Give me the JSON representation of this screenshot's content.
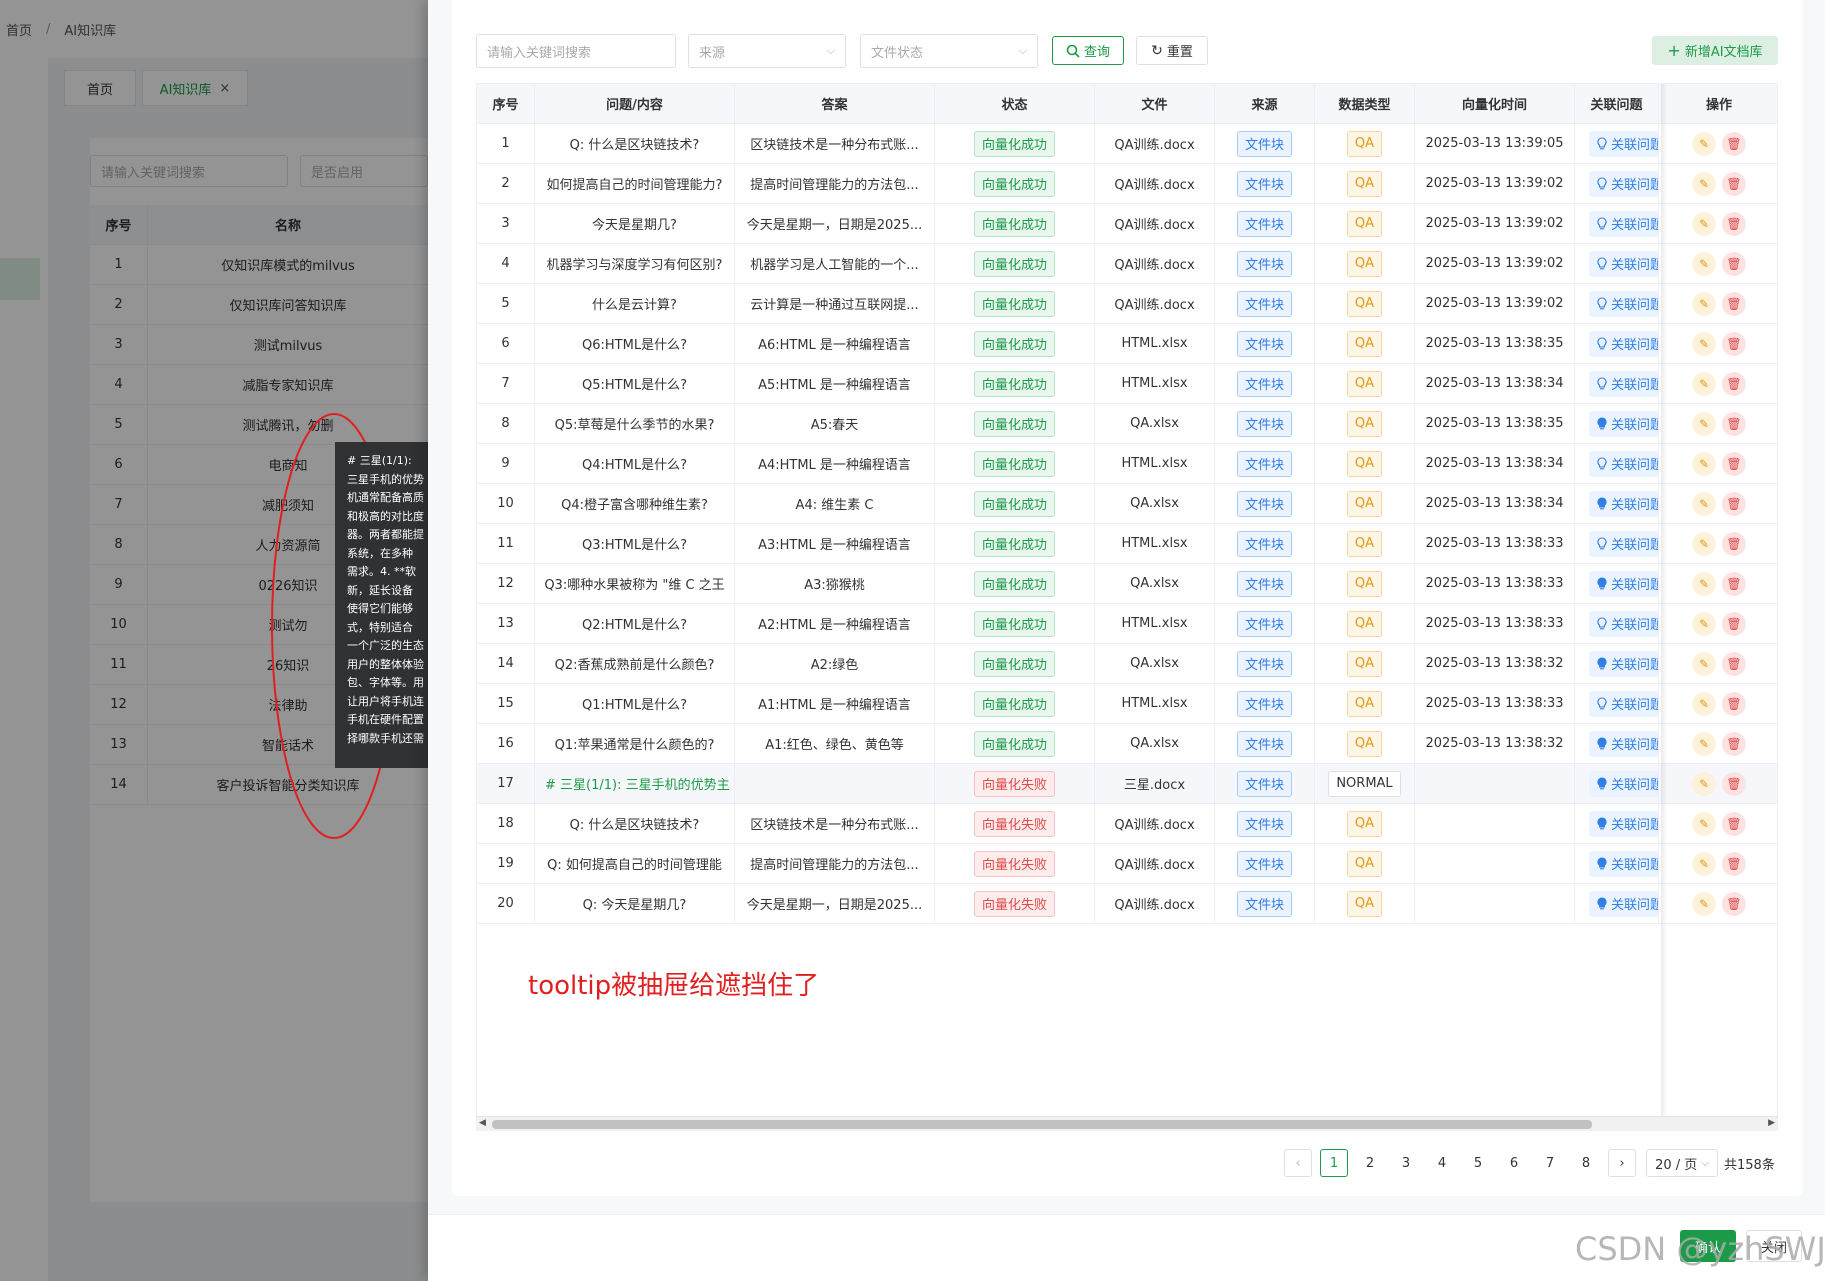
{
  "background": {
    "breadcrumb": [
      "首页",
      "AI知识库"
    ],
    "tabs": [
      "首页",
      "AI知识库"
    ],
    "search_placeholder": "请输入关键词搜索",
    "enabled_placeholder": "是否启用",
    "table": {
      "headers": [
        "序号",
        "名称"
      ],
      "rows": [
        [
          "1",
          "仅知识库模式的milvus"
        ],
        [
          "2",
          "仅知识库问答知识库"
        ],
        [
          "3",
          "测试milvus"
        ],
        [
          "4",
          "减脂专家知识库"
        ],
        [
          "5",
          "测试腾讯，勿删"
        ],
        [
          "6",
          "电商知"
        ],
        [
          "7",
          "减肥须知"
        ],
        [
          "8",
          "人力资源简"
        ],
        [
          "9",
          "0226知识"
        ],
        [
          "10",
          "测试勿"
        ],
        [
          "11",
          "26知识"
        ],
        [
          "12",
          "法律助"
        ],
        [
          "13",
          "智能话术"
        ],
        [
          "14",
          "客户投诉智能分类知识库"
        ]
      ]
    }
  },
  "tooltip": {
    "lines": [
      "# 三星(1/1):",
      "三星手机的优势",
      "机通常配备高质",
      "和极高的对比度",
      "器。两者都能提",
      "系统，在多种",
      "需求。4. **软",
      "新，延长设备",
      "使得它们能够",
      "式，特别适合",
      "一个广泛的生态",
      "用户的整体体验",
      "包、字体等。用",
      "让用户将手机连",
      "手机在硬件配置",
      "择哪款手机还需"
    ]
  },
  "drawer": {
    "filters": {
      "keyword_placeholder": "请输入关键词搜索",
      "source_placeholder": "来源",
      "status_placeholder": "文件状态",
      "search_button": "查询",
      "reset_button": "重置",
      "add_button": "新增AI文档库"
    },
    "table": {
      "headers": [
        "序号",
        "问题/内容",
        "答案",
        "状态",
        "文件",
        "来源",
        "数据类型",
        "向量化时间",
        "关联问题",
        "操作"
      ],
      "rows": [
        {
          "no": "1",
          "q": "Q: 什么是区块链技术?",
          "a": "区块链技术是一种分布式账...",
          "status": "向量化成功",
          "ok": true,
          "file": "QA训练.docx",
          "src": "文件块",
          "type": "QA",
          "time": "2025-03-13 13:39:05",
          "rel": "关联问题"
        },
        {
          "no": "2",
          "q": "如何提高自己的时间管理能力?",
          "a": "提高时间管理能力的方法包...",
          "status": "向量化成功",
          "ok": true,
          "file": "QA训练.docx",
          "src": "文件块",
          "type": "QA",
          "time": "2025-03-13 13:39:02",
          "rel": "关联问题"
        },
        {
          "no": "3",
          "q": "今天是星期几?",
          "a": "今天是星期一，日期是2025...",
          "status": "向量化成功",
          "ok": true,
          "file": "QA训练.docx",
          "src": "文件块",
          "type": "QA",
          "time": "2025-03-13 13:39:02",
          "rel": "关联问题"
        },
        {
          "no": "4",
          "q": "机器学习与深度学习有何区别?",
          "a": "机器学习是人工智能的一个...",
          "status": "向量化成功",
          "ok": true,
          "file": "QA训练.docx",
          "src": "文件块",
          "type": "QA",
          "time": "2025-03-13 13:39:02",
          "rel": "关联问题"
        },
        {
          "no": "5",
          "q": "什么是云计算?",
          "a": "云计算是一种通过互联网提...",
          "status": "向量化成功",
          "ok": true,
          "file": "QA训练.docx",
          "src": "文件块",
          "type": "QA",
          "time": "2025-03-13 13:39:02",
          "rel": "关联问题"
        },
        {
          "no": "6",
          "q": "Q6:HTML是什么?",
          "a": "A6:HTML 是一种编程语言",
          "status": "向量化成功",
          "ok": true,
          "file": "HTML.xlsx",
          "src": "文件块",
          "type": "QA",
          "time": "2025-03-13 13:38:35",
          "rel": "关联问题"
        },
        {
          "no": "7",
          "q": "Q5:HTML是什么?",
          "a": "A5:HTML 是一种编程语言",
          "status": "向量化成功",
          "ok": true,
          "file": "HTML.xlsx",
          "src": "文件块",
          "type": "QA",
          "time": "2025-03-13 13:38:34",
          "rel": "关联问题"
        },
        {
          "no": "8",
          "q": "Q5:草莓是什么季节的水果?",
          "a": "A5:春天",
          "status": "向量化成功",
          "ok": true,
          "file": "QA.xlsx",
          "src": "文件块",
          "type": "QA",
          "time": "2025-03-13 13:38:35",
          "rel": "关联问题"
        },
        {
          "no": "9",
          "q": "Q4:HTML是什么?",
          "a": "A4:HTML 是一种编程语言",
          "status": "向量化成功",
          "ok": true,
          "file": "HTML.xlsx",
          "src": "文件块",
          "type": "QA",
          "time": "2025-03-13 13:38:34",
          "rel": "关联问题"
        },
        {
          "no": "10",
          "q": "Q4:橙子富含哪种维生素?",
          "a": "A4: 维生素 C",
          "status": "向量化成功",
          "ok": true,
          "file": "QA.xlsx",
          "src": "文件块",
          "type": "QA",
          "time": "2025-03-13 13:38:34",
          "rel": "关联问题"
        },
        {
          "no": "11",
          "q": "Q3:HTML是什么?",
          "a": "A3:HTML 是一种编程语言",
          "status": "向量化成功",
          "ok": true,
          "file": "HTML.xlsx",
          "src": "文件块",
          "type": "QA",
          "time": "2025-03-13 13:38:33",
          "rel": "关联问题"
        },
        {
          "no": "12",
          "q": "Q3:哪种水果被称为 \"维 C 之王",
          "a": "A3:猕猴桃",
          "status": "向量化成功",
          "ok": true,
          "file": "QA.xlsx",
          "src": "文件块",
          "type": "QA",
          "time": "2025-03-13 13:38:33",
          "rel": "关联问题"
        },
        {
          "no": "13",
          "q": "Q2:HTML是什么?",
          "a": "A2:HTML 是一种编程语言",
          "status": "向量化成功",
          "ok": true,
          "file": "HTML.xlsx",
          "src": "文件块",
          "type": "QA",
          "time": "2025-03-13 13:38:33",
          "rel": "关联问题"
        },
        {
          "no": "14",
          "q": "Q2:香蕉成熟前是什么颜色?",
          "a": "A2:绿色",
          "status": "向量化成功",
          "ok": true,
          "file": "QA.xlsx",
          "src": "文件块",
          "type": "QA",
          "time": "2025-03-13 13:38:32",
          "rel": "关联问题"
        },
        {
          "no": "15",
          "q": "Q1:HTML是什么?",
          "a": "A1:HTML 是一种编程语言",
          "status": "向量化成功",
          "ok": true,
          "file": "HTML.xlsx",
          "src": "文件块",
          "type": "QA",
          "time": "2025-03-13 13:38:33",
          "rel": "关联问题"
        },
        {
          "no": "16",
          "q": "Q1:苹果通常是什么颜色的?",
          "a": "A1:红色、绿色、黄色等",
          "status": "向量化成功",
          "ok": true,
          "file": "QA.xlsx",
          "src": "文件块",
          "type": "QA",
          "time": "2025-03-13 13:38:32",
          "rel": "关联问题"
        },
        {
          "no": "17",
          "q": "# 三星(1/1): 三星手机的优势主",
          "a": "",
          "status": "向量化失败",
          "ok": false,
          "file": "三星.docx",
          "src": "文件块",
          "type": "NORMAL",
          "time": "",
          "rel": "关联问题"
        },
        {
          "no": "18",
          "q": "Q: 什么是区块链技术?",
          "a": "区块链技术是一种分布式账...",
          "status": "向量化失败",
          "ok": false,
          "file": "QA训练.docx",
          "src": "文件块",
          "type": "QA",
          "time": "",
          "rel": "关联问题"
        },
        {
          "no": "19",
          "q": "Q: 如何提高自己的时间管理能",
          "a": "提高时间管理能力的方法包...",
          "status": "向量化失败",
          "ok": false,
          "file": "QA训练.docx",
          "src": "文件块",
          "type": "QA",
          "time": "",
          "rel": "关联问题"
        },
        {
          "no": "20",
          "q": "Q: 今天是星期几?",
          "a": "今天是星期一，日期是2025...",
          "status": "向量化失败",
          "ok": false,
          "file": "QA训练.docx",
          "src": "文件块",
          "type": "QA",
          "time": "",
          "rel": "关联问题"
        }
      ]
    },
    "pagination": {
      "pages": [
        "1",
        "2",
        "3",
        "4",
        "5",
        "6",
        "7",
        "8"
      ],
      "current": "1",
      "page_size": "20 / 页",
      "total": "共158条"
    },
    "annotation": "tooltip被抽屉给遮挡住了",
    "footer": {
      "confirm": "确认",
      "close": "关闭"
    }
  },
  "watermark": "CSDN @yzhSWJ",
  "colors": {
    "primary": "#1b9b48",
    "danger": "#e24a4a",
    "info": "#2f7fe6",
    "warning": "#e39a10",
    "annotation": "#e02020"
  }
}
